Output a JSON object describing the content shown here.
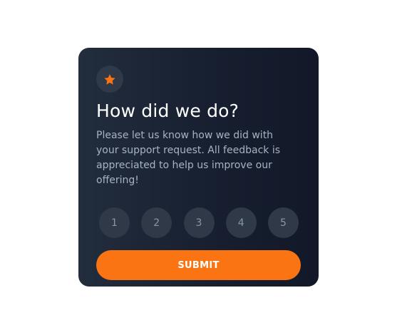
{
  "card": {
    "icon": "star-icon",
    "title": "How did we do?",
    "description": "Please let us know how we did with your support request. All feedback is appreciated to help us improve our offering!",
    "ratings": [
      "1",
      "2",
      "3",
      "4",
      "5"
    ],
    "submit_label": "SUBMIT"
  },
  "colors": {
    "accent": "#fb7413",
    "card_background": "#171f30",
    "circle_background": "#2f3947",
    "title_text": "#ffffff",
    "body_text": "#a8b3c2"
  }
}
